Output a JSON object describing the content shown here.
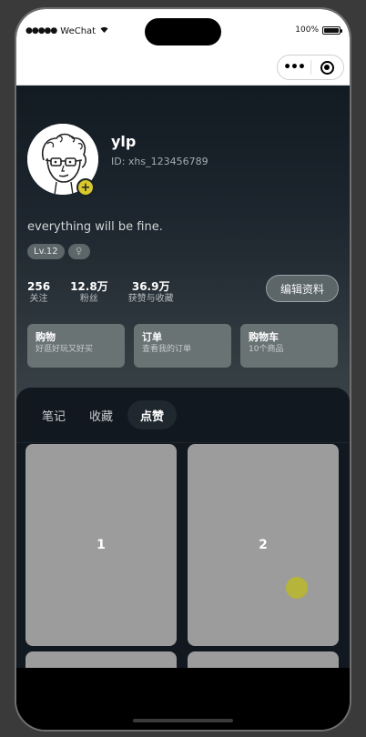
{
  "status_bar": {
    "carrier": "WeChat",
    "battery": "100%"
  },
  "profile": {
    "username": "ylp",
    "user_id": "ID: xhs_123456789",
    "bio": "everything will be fine.",
    "level": "Lv.12",
    "gender_symbol": "♀",
    "avatar_add": "+"
  },
  "stats": [
    {
      "value": "256",
      "label": "关注"
    },
    {
      "value": "12.8万",
      "label": "粉丝"
    },
    {
      "value": "36.9万",
      "label": "获赞与收藏"
    }
  ],
  "edit_button": "编辑资料",
  "shortcuts": [
    {
      "title": "购物",
      "subtitle": "好逛好玩又好买"
    },
    {
      "title": "订单",
      "subtitle": "查看我的订单"
    },
    {
      "title": "购物车",
      "subtitle": "10个商品"
    }
  ],
  "tabs": [
    {
      "label": "笔记",
      "active": false
    },
    {
      "label": "收藏",
      "active": false
    },
    {
      "label": "点赞",
      "active": true
    }
  ],
  "cards": [
    {
      "label": "1"
    },
    {
      "label": "2"
    },
    {
      "label": ""
    },
    {
      "label": ""
    }
  ],
  "colors": {
    "accent_yellow": "#d9c82c",
    "card_gray": "#9c9c9c",
    "background": "#0f141a"
  },
  "icons": [
    "wifi-icon",
    "battery-icon",
    "more-dots-icon",
    "mini-program-close-icon",
    "add-icon",
    "female-icon"
  ]
}
